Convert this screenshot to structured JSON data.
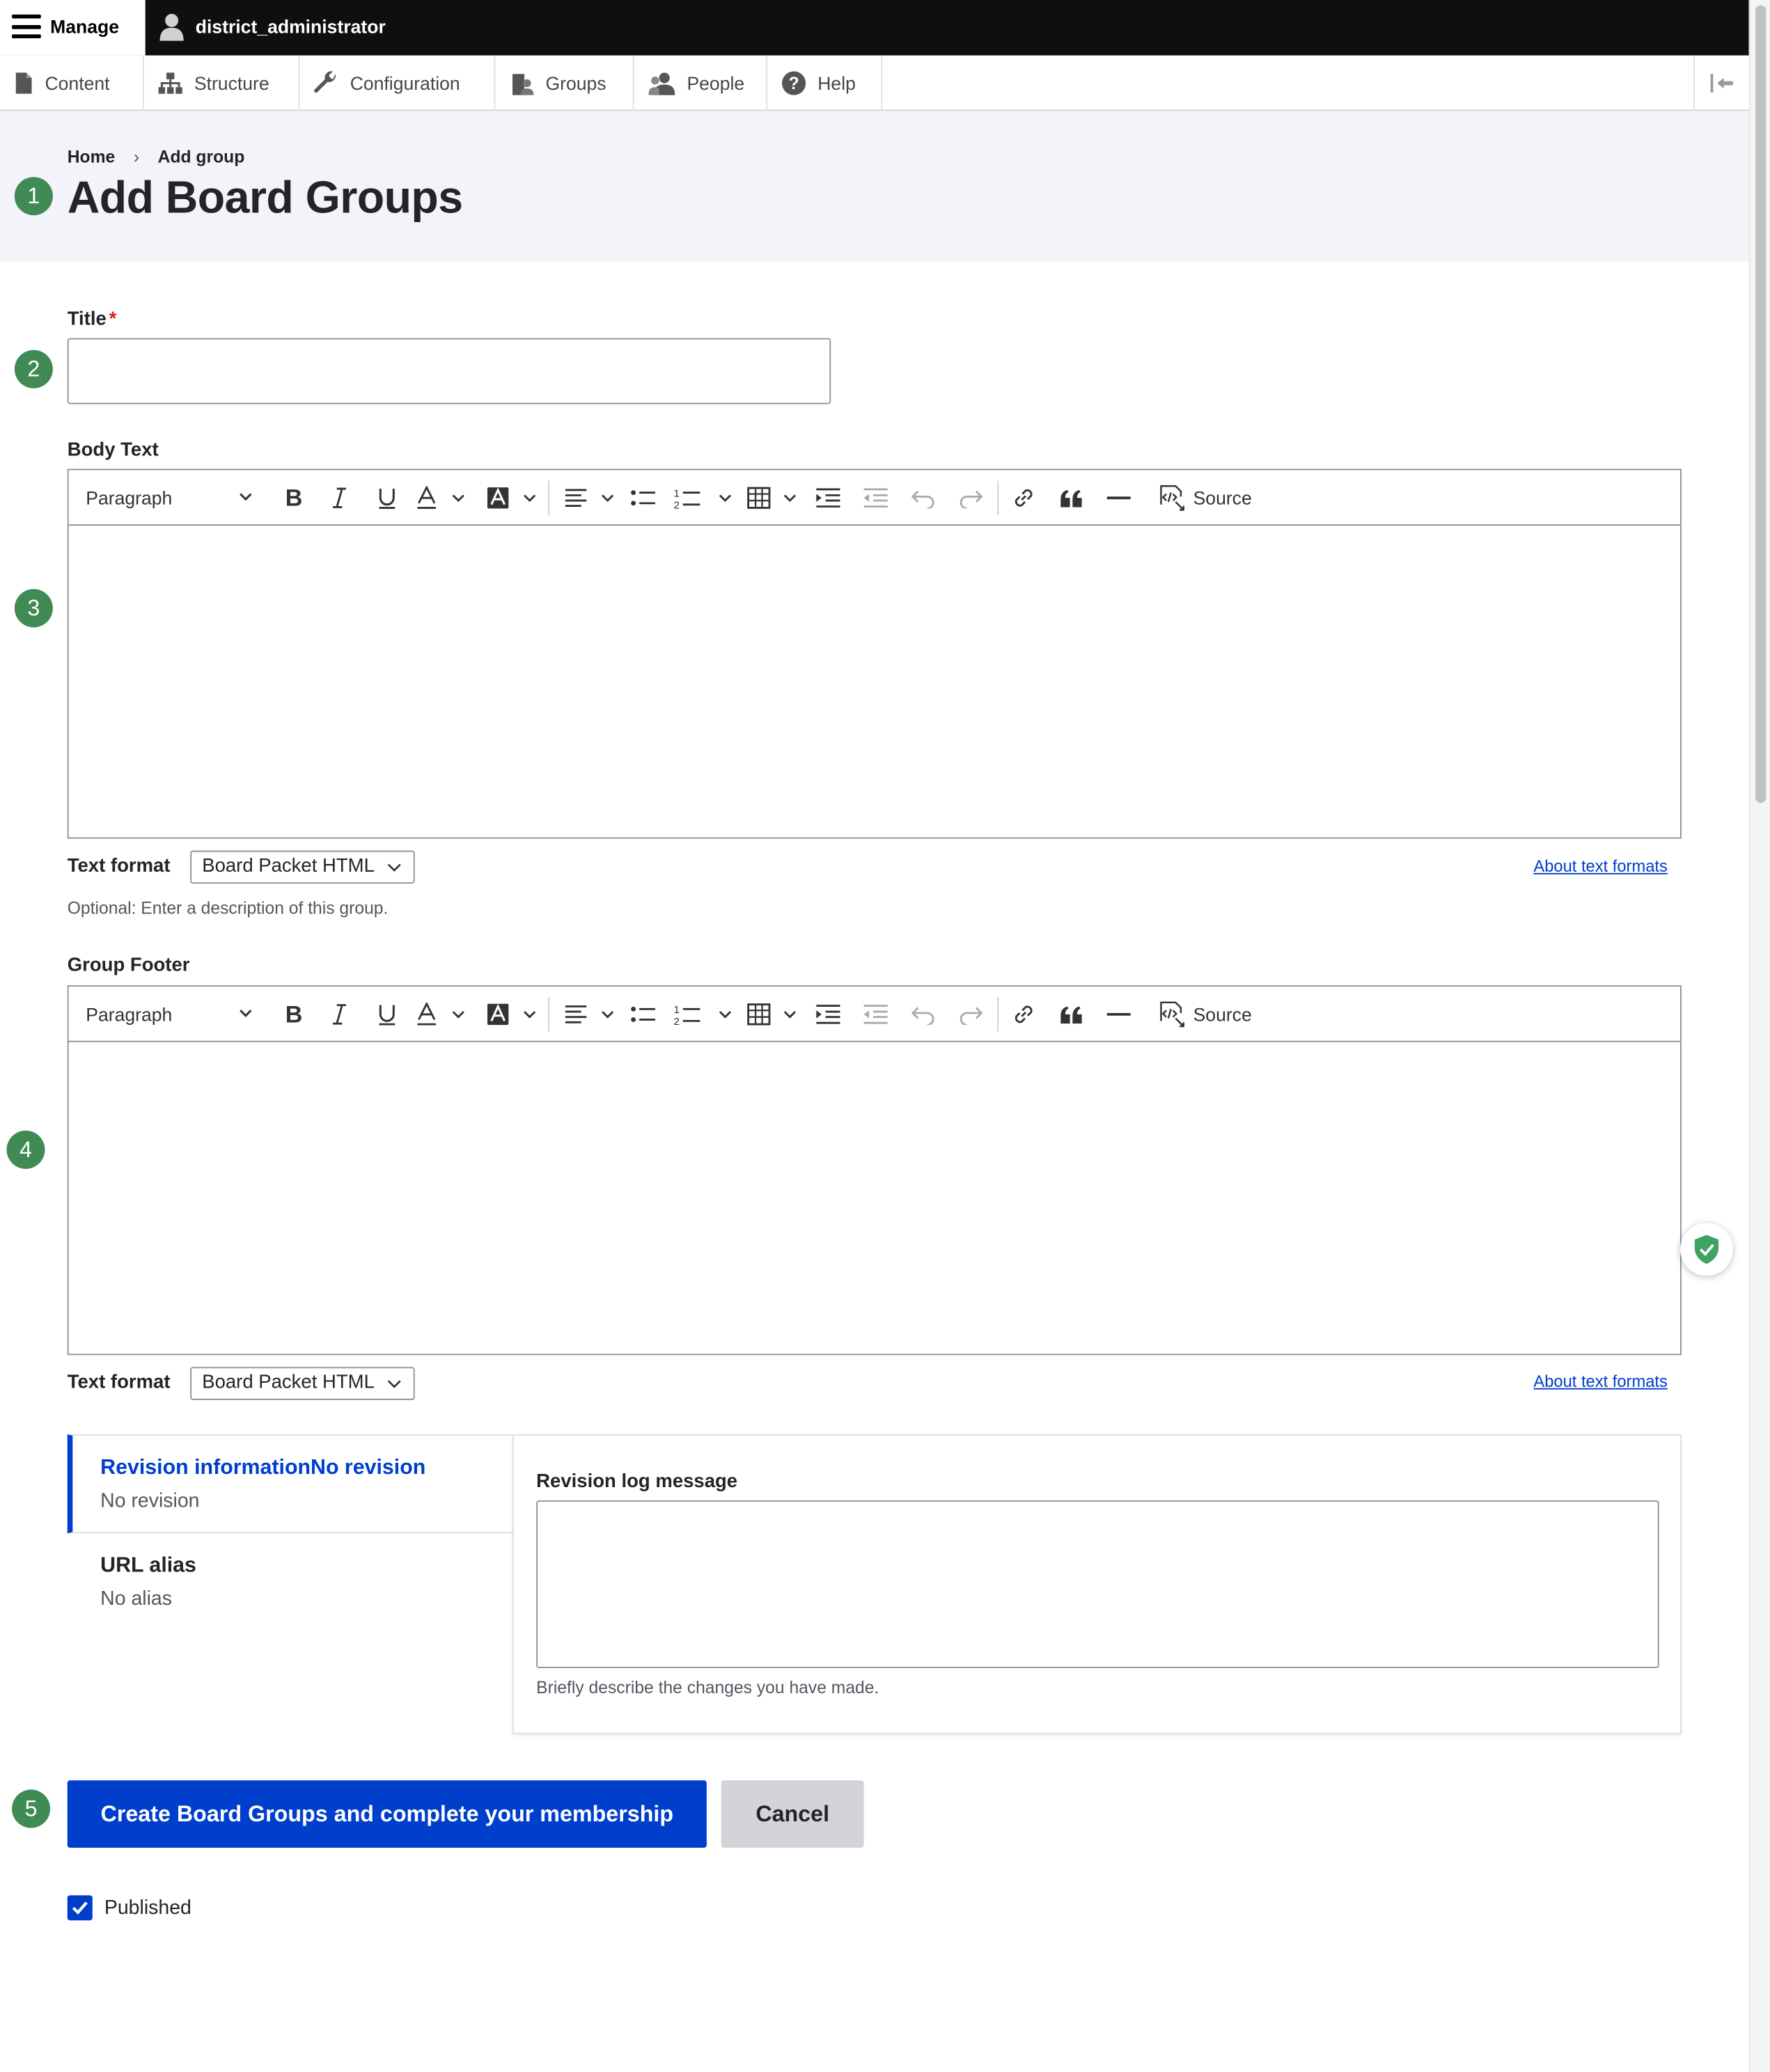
{
  "toolbar": {
    "manage_label": "Manage",
    "user_label": "district_administrator"
  },
  "tray": {
    "items": [
      {
        "label": "Content",
        "icon": "file-icon"
      },
      {
        "label": "Structure",
        "icon": "sitemap-icon"
      },
      {
        "label": "Configuration",
        "icon": "wrench-icon"
      },
      {
        "label": "Groups",
        "icon": "groups-icon"
      },
      {
        "label": "People",
        "icon": "people-icon"
      },
      {
        "label": "Help",
        "icon": "help-icon"
      }
    ]
  },
  "breadcrumb": {
    "home": "Home",
    "separator": "›",
    "current": "Add group"
  },
  "page": {
    "title": "Add Board Groups"
  },
  "markers": [
    "1",
    "2",
    "3",
    "4",
    "5"
  ],
  "form": {
    "title_label": "Title",
    "required_mark": "*",
    "title_value": "",
    "body": {
      "label": "Body Text",
      "format_label": "Text format",
      "format_value": "Board Packet HTML",
      "about_link": "About text formats",
      "description": "Optional: Enter a description of this group."
    },
    "footer": {
      "label": "Group Footer",
      "format_label": "Text format",
      "format_value": "Board Packet HTML",
      "about_link": "About text formats"
    },
    "editor_toolbar": {
      "paragraph_label": "Paragraph",
      "source_label": "Source"
    },
    "vertical_tabs": {
      "revision_title": "Revision informationNo revision",
      "revision_summary": "No revision",
      "url_title": "URL alias",
      "url_summary": "No alias",
      "log_label": "Revision log message",
      "log_value": "",
      "log_description": "Briefly describe the changes you have made."
    },
    "submit_label": "Create Board Groups and complete your membership",
    "cancel_label": "Cancel",
    "published_label": "Published",
    "published_checked": true
  },
  "colors": {
    "primary": "#003ecc",
    "marker": "#3f8a55",
    "admin_bar": "#0f0f0f",
    "header_bg": "#f3f4f9"
  }
}
